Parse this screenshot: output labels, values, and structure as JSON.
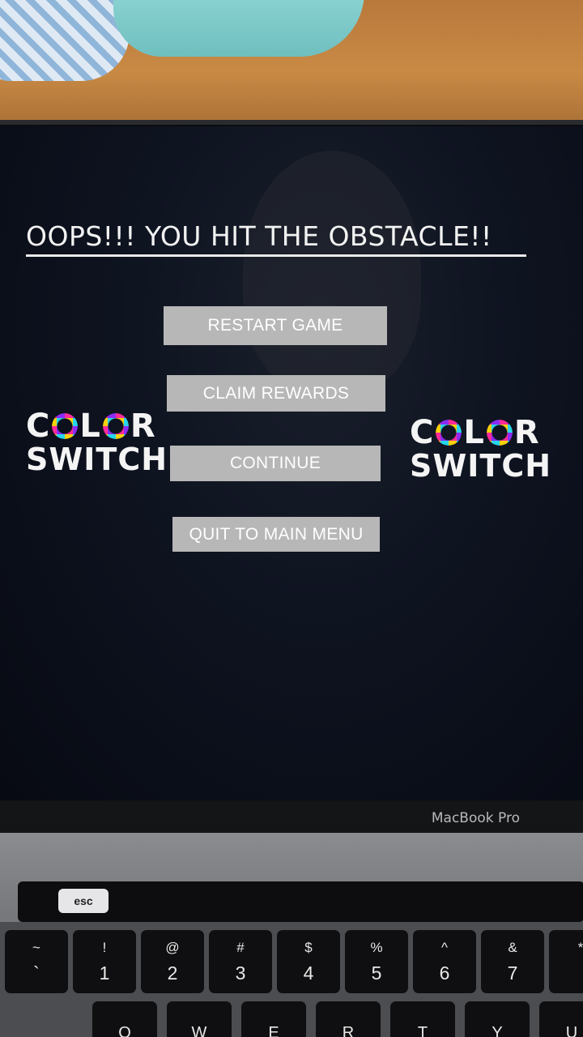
{
  "game": {
    "message": "OOPS!!! YOU HIT THE OBSTACLE!!",
    "buttons": {
      "restart": "RESTART GAME",
      "claim": "CLAIM REWARDS",
      "continue": "CONTINUE",
      "quit": "QUIT TO MAIN MENU"
    },
    "logo": {
      "line1_left": "C",
      "line1_right_a": "L",
      "line1_right_b": "R",
      "line2": "SWITCH"
    }
  },
  "laptop": {
    "brand": "MacBook Pro",
    "esc_label": "esc",
    "number_keys": [
      {
        "sym": "~",
        "num": "`"
      },
      {
        "sym": "!",
        "num": "1"
      },
      {
        "sym": "@",
        "num": "2"
      },
      {
        "sym": "#",
        "num": "3"
      },
      {
        "sym": "$",
        "num": "4"
      },
      {
        "sym": "%",
        "num": "5"
      },
      {
        "sym": "^",
        "num": "6"
      },
      {
        "sym": "&",
        "num": "7"
      },
      {
        "sym": "*",
        "num": ""
      }
    ],
    "letter_keys": [
      "Q",
      "W",
      "E",
      "R",
      "T",
      "Y",
      "U"
    ]
  },
  "colors": {
    "button_bg": "#b7b7b7",
    "screen_bg": "#0e1320",
    "ring_yellow": "#f5d10a",
    "ring_pink": "#ff2a9a",
    "ring_purple": "#8b2cf5",
    "ring_cyan": "#26d6ea"
  }
}
